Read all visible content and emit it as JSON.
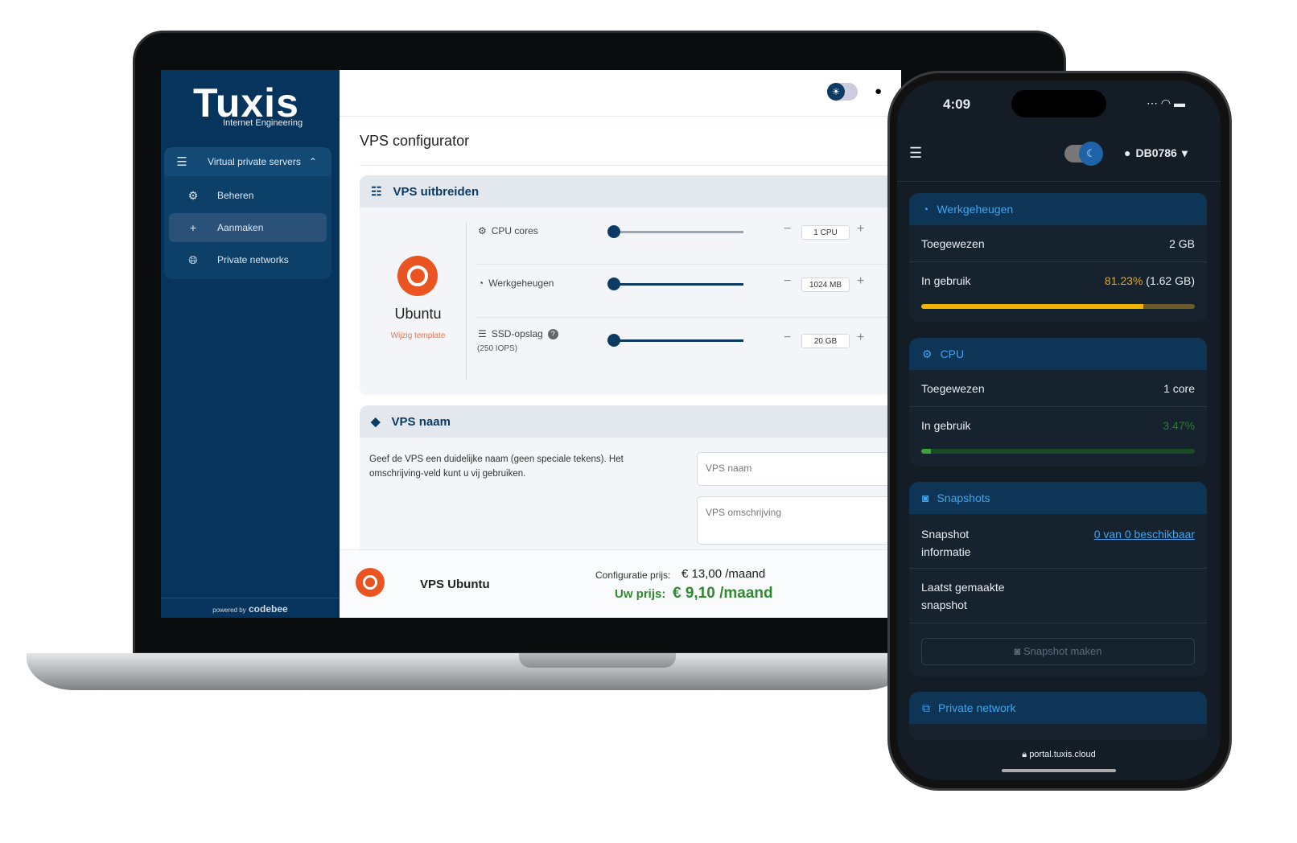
{
  "laptop": {
    "sidebar": {
      "logo": "Tuxis",
      "logo_sub": "Internet Engineering",
      "group": "Virtual private servers",
      "items": [
        {
          "label": "Beheren",
          "icon": "gear-icon"
        },
        {
          "label": "Aanmaken",
          "icon": "plus-icon",
          "active": true
        },
        {
          "label": "Private networks",
          "icon": "globe-icon"
        }
      ],
      "powered": "powered by",
      "powered_brand": "codebee"
    },
    "title": "VPS configurator",
    "extend": {
      "heading": "VPS uitbreiden",
      "os": "Ubuntu",
      "change_template": "Wijzig template",
      "rows": [
        {
          "label": "CPU cores",
          "icon": "cpu-icon",
          "value": "1 CPU",
          "slider_fraction": 0
        },
        {
          "label": "Werkgeheugen",
          "icon": "gauge-icon",
          "value": "1024 MB",
          "slider_fraction": 0
        },
        {
          "label": "SSD-opslag",
          "sub": "(250 IOPS)",
          "icon": "storage-icon",
          "value": "20 GB",
          "slider_fraction": 0
        }
      ]
    },
    "name": {
      "heading": "VPS naam",
      "description": "Geef de VPS een duidelijke naam (geen speciale tekens). Het omschrijving-veld kunt u vij gebruiken.",
      "name_placeholder": "VPS naam",
      "desc_placeholder": "VPS omschrijving"
    },
    "footer": {
      "product": "VPS Ubuntu",
      "config_label": "Configuratie prijs:",
      "config_price": "€ 13,00 /maand",
      "your_label": "Uw prijs:",
      "your_price": "€ 9,10 /maand"
    }
  },
  "phone": {
    "time": "4:09",
    "user": "DB0786",
    "url": "portal.tuxis.cloud",
    "memory": {
      "heading": "Werkgeheugen",
      "assigned_label": "Toegewezen",
      "assigned": "2 GB",
      "used_label": "In gebruik",
      "used_pct": "81.23%",
      "used_abs": "(1.62 GB)",
      "fraction": 0.8123
    },
    "cpu": {
      "heading": "CPU",
      "assigned_label": "Toegewezen",
      "assigned": "1 core",
      "used_label": "In gebruik",
      "used_pct": "3.47%",
      "fraction": 0.0347
    },
    "snapshots": {
      "heading": "Snapshots",
      "info_label": "Snapshot informatie",
      "info_value": "0 van 0 beschikbaar",
      "last_label": "Laatst gemaakte snapshot",
      "button": "Snapshot maken"
    },
    "network": {
      "heading": "Private network"
    }
  },
  "colors": {
    "navy": "#06345c",
    "ubuntu": "#e95420",
    "green": "#2e8b2e",
    "amber": "#f0b400",
    "phone_accent": "#3ea6f0"
  }
}
